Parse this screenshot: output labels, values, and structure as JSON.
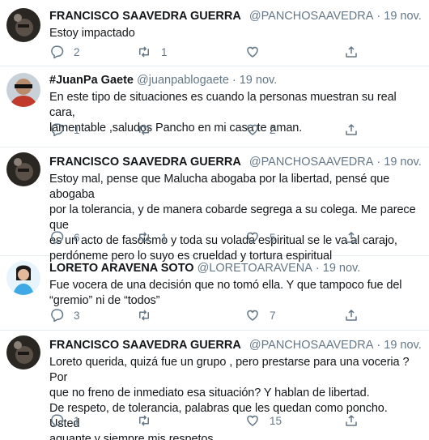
{
  "colors": {
    "accent": "#1da1f2",
    "secondary_text": "#657786",
    "divider": "#e6ecf0"
  },
  "tweets": [
    {
      "name": "FRANCISCO SAAVEDRA GUERRA",
      "handle": "@PANCHOSAAVEDRA",
      "separator": "·",
      "date": "19 nov.",
      "verified": true,
      "lines": [
        "Estoy impactado"
      ],
      "reply_count": "2",
      "retweet_count": "1",
      "like_count": ""
    },
    {
      "name": "#JuanPa Gaete",
      "handle": "@juanpablogaete",
      "separator": "·",
      "date": "19 nov.",
      "verified": false,
      "lines": [
        "En este tipo de situaciones es cuando la personas muestran su real cara,",
        "lamentable ,saludos Pancho en mi casa te aman."
      ],
      "reply_count": "1",
      "retweet_count": "",
      "like_count": "2"
    },
    {
      "name": "FRANCISCO SAAVEDRA GUERRA",
      "handle": "@PANCHOSAAVEDRA",
      "separator": "·",
      "date": "19 nov.",
      "verified": true,
      "lines": [
        "Estoy mal, pense que Malucha abogaba por la libertad, pensé que abogaba",
        "por la tolerancia, y de manera cobarde segrega a su colega. Me parece que",
        "es un acto de fascismo y toda su volada espiritual se le va al carajo,",
        "perdóneme pero lo suyo es crueldad y tortura espiritual"
      ],
      "reply_count": "6",
      "retweet_count": "1",
      "like_count": "5"
    },
    {
      "name": "LORETO ARAVENA SOTO",
      "handle": "@LORETOARAVENA",
      "separator": "·",
      "date": "19 nov.",
      "verified": false,
      "lines": [
        "Fue vocera de una decisión que no tomó ella. Y que tampoco fue del",
        "“gremio” ni de “todos”"
      ],
      "reply_count": "3",
      "retweet_count": "",
      "like_count": "7"
    },
    {
      "name": "FRANCISCO SAAVEDRA GUERRA",
      "handle": "@PANCHOSAAVEDRA",
      "separator": "·",
      "date": "19 nov.",
      "verified": true,
      "lines": [
        "Loreto querida, quizá fue un grupo , pero prestarse para una voceria ? Por",
        "que no freno de inmediato esa situación? Y hablan de libertad.",
        "De respeto, de tolerancia, palabras que les quedan como poncho. Usted",
        "aguante y siempre mis respetos"
      ],
      "reply_count": "1",
      "retweet_count": "",
      "like_count": "15"
    }
  ]
}
